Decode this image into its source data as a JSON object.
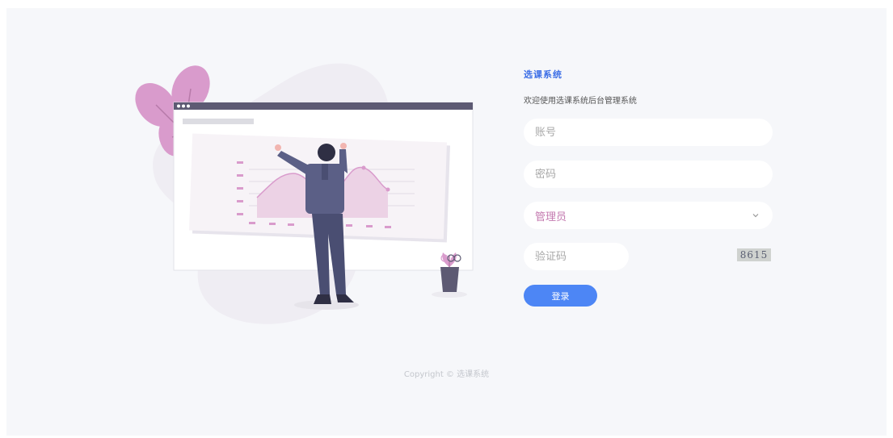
{
  "app": {
    "title": "选课系统",
    "subtitle": "欢迎使用选课系统后台管理系统"
  },
  "form": {
    "account_placeholder": "账号",
    "password_placeholder": "密码",
    "role_selected": "管理员",
    "captcha_placeholder": "验证码",
    "captcha_text": "8615",
    "login_label": "登录"
  },
  "footer": {
    "copyright": "Copyright © 选课系统"
  },
  "colors": {
    "accent": "#4d86f5",
    "title": "#3c6ee6",
    "illustration_pink": "#d99bcc",
    "figure": "#5b5f86"
  },
  "icons": {
    "role_dropdown": "chevron-down-icon"
  }
}
